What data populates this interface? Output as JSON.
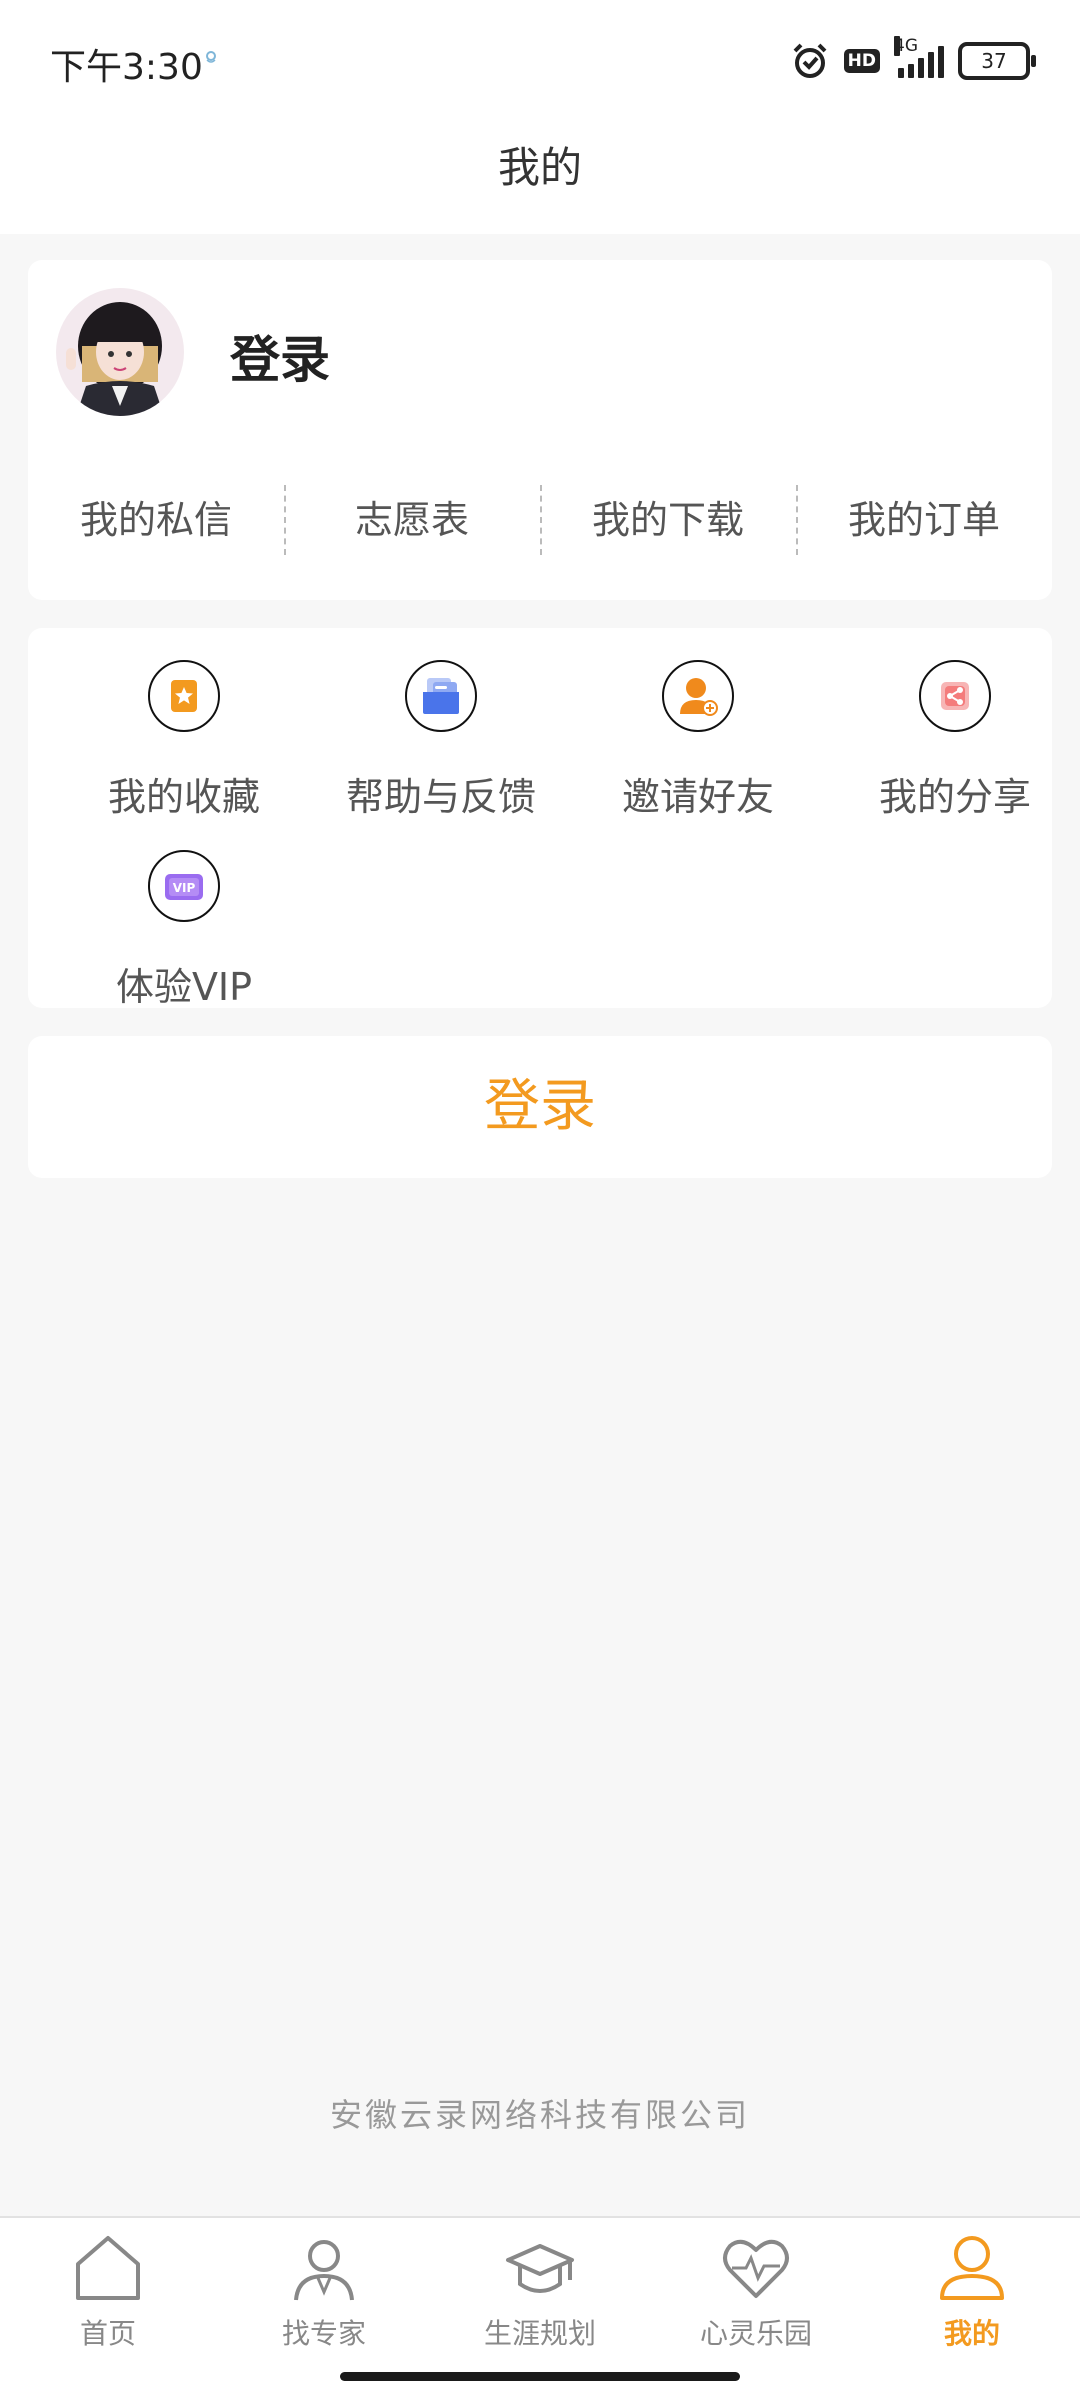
{
  "status_bar": {
    "time": "下午3:30",
    "battery": "37",
    "network": "4G",
    "hd": "HD"
  },
  "header": {
    "title": "我的"
  },
  "profile": {
    "name": "登录",
    "quick_links": [
      {
        "label": "我的私信"
      },
      {
        "label": "志愿表"
      },
      {
        "label": "我的下载"
      },
      {
        "label": "我的订单"
      }
    ]
  },
  "features": [
    {
      "label": "我的收藏",
      "icon": "bookmark-star-icon"
    },
    {
      "label": "帮助与反馈",
      "icon": "feedback-folder-icon"
    },
    {
      "label": "邀请好友",
      "icon": "invite-user-icon"
    },
    {
      "label": "我的分享",
      "icon": "share-icon"
    },
    {
      "label": "体验VIP",
      "icon": "vip-icon"
    }
  ],
  "login_button": {
    "label": "登录"
  },
  "footer": {
    "company": "安徽云录网络科技有限公司"
  },
  "bottom_nav": [
    {
      "label": "首页",
      "icon": "home-icon",
      "active": false
    },
    {
      "label": "找专家",
      "icon": "expert-icon",
      "active": false
    },
    {
      "label": "生涯规划",
      "icon": "graduation-cap-icon",
      "active": false
    },
    {
      "label": "心灵乐园",
      "icon": "heart-pulse-icon",
      "active": false
    },
    {
      "label": "我的",
      "icon": "user-icon",
      "active": true
    }
  ],
  "colors": {
    "accent": "#f39a1f",
    "background": "#f7f7f7",
    "card": "#ffffff",
    "text": "#333333"
  }
}
